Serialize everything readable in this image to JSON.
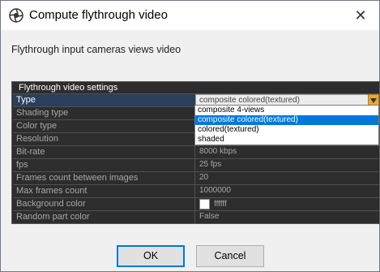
{
  "window": {
    "title": "Compute flythrough video",
    "close_glyph": "✕"
  },
  "subtitle": "Flythrough input cameras views video",
  "settings": {
    "header": "Flythrough video settings",
    "rows": [
      {
        "label": "Type",
        "value": "composite colored(textured)"
      },
      {
        "label": "Shading type",
        "value": ""
      },
      {
        "label": "Color type",
        "value": ""
      },
      {
        "label": "Resolution",
        "value": ""
      },
      {
        "label": "Bit-rate",
        "value": "8000 kbps"
      },
      {
        "label": "fps",
        "value": "25 fps"
      },
      {
        "label": "Frames count between images",
        "value": "20"
      },
      {
        "label": "Max frames count",
        "value": "1000000"
      },
      {
        "label": "Background color",
        "value": "ffffff"
      },
      {
        "label": "Random part color",
        "value": "False"
      }
    ]
  },
  "type_dropdown": {
    "options": [
      "composite 4-views",
      "composite colored(textured)",
      "colored(textured)",
      "shaded"
    ],
    "selected_index": 1
  },
  "buttons": {
    "ok": "OK",
    "cancel": "Cancel"
  },
  "colors": {
    "accent": "#0078d7",
    "grid_bg": "#2d2d2d",
    "dropdown_arrow": "#e8a93c",
    "background_color_swatch": "#ffffff"
  },
  "icons": {
    "app": "camera-shutter-icon",
    "close": "close-icon",
    "dropdown": "chevron-down-icon"
  }
}
